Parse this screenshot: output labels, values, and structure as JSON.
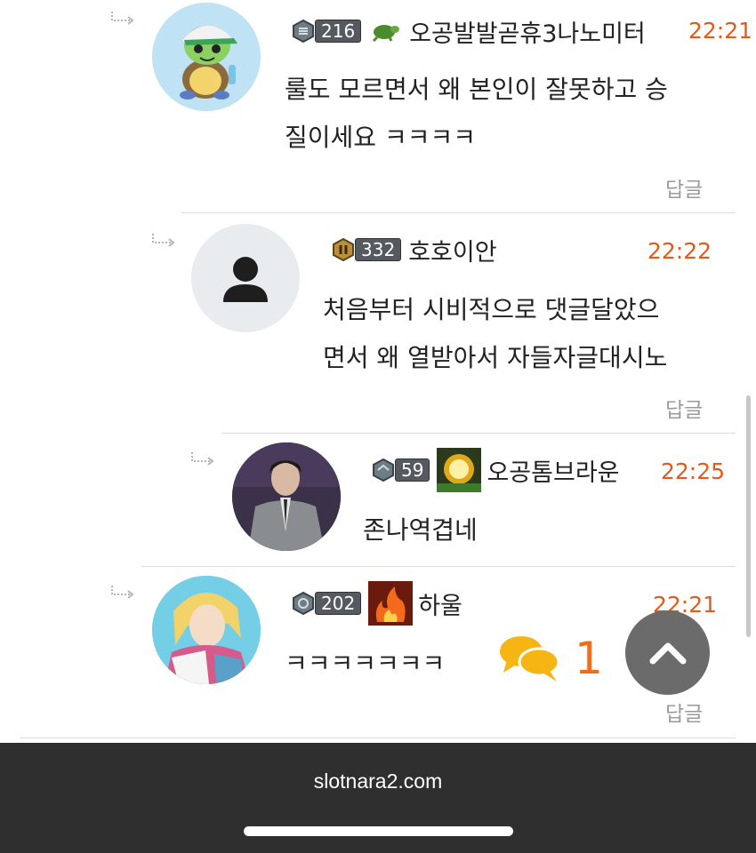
{
  "comments": [
    {
      "level": "216",
      "author": "오공발발곧휴3나노미터",
      "time": "22:21",
      "text_lines": [
        "룰도 모르면서 왜 본인이 잘못하고 승",
        "질이세요 ㅋㅋㅋㅋ"
      ],
      "reply_label": "답글"
    },
    {
      "level": "332",
      "author": "호호이안",
      "time": "22:22",
      "text_lines": [
        "처음부터 시비적으로 댓글달았으",
        "면서 왜 열받아서 자들자글대시노"
      ],
      "reply_label": "답글"
    },
    {
      "level": "59",
      "author": "오공톰브라운",
      "time": "22:25",
      "text_lines": [
        "존나역겹네"
      ]
    },
    {
      "level": "202",
      "author": "하울",
      "time": "22:21",
      "text_lines": [
        "ㅋㅋㅋㅋㅋㅋㅋ"
      ],
      "reply_label": "답글"
    }
  ],
  "floating": {
    "chat_count": "1"
  },
  "footer": {
    "domain": "slotnara2.com"
  },
  "colors": {
    "time": "#e15b1e",
    "accent_orange": "#f36c1a",
    "chat_yellow": "#f6b512",
    "bar": "#2f2f2f"
  }
}
